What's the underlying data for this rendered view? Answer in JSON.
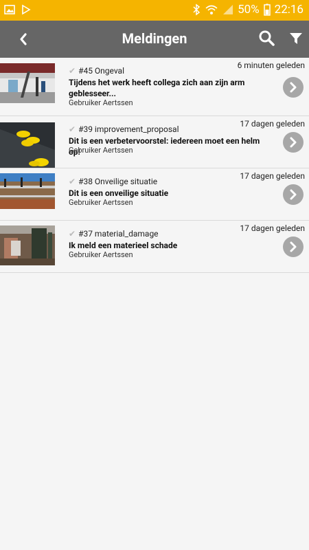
{
  "status": {
    "battery": "50%",
    "time": "22:16"
  },
  "header": {
    "title": "Meldingen"
  },
  "notifications": [
    {
      "number": "#45 Ongeval",
      "time": "6 minuten geleden",
      "description": "Tijdens het werk heeft collega zich aan zijn arm geblesseer...",
      "user": "Gebruiker Aertssen"
    },
    {
      "number": "#39 improvement_proposal",
      "time": "17 dagen geleden",
      "description": "Dit is een verbetervoorstel: iedereen moet een helm op!",
      "user": "Gebruiker Aertssen"
    },
    {
      "number": "#38 Onveilige situatie",
      "time": "17 dagen geleden",
      "description": "Dit is een onveilige situatie",
      "user": "Gebruiker Aertssen"
    },
    {
      "number": "#37 material_damage",
      "time": "17 dagen geleden",
      "description": "Ik meld een materieel schade",
      "user": "Gebruiker Aertssen"
    }
  ]
}
